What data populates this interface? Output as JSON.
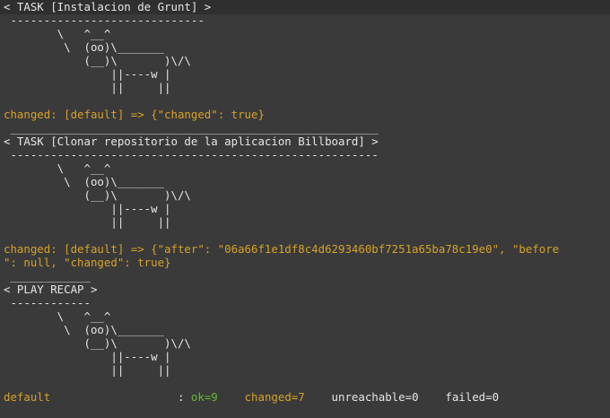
{
  "terminal": {
    "lines": [
      {
        "text": "< TASK [Instalacion de Grunt] >",
        "color": "white"
      },
      {
        "text": " -----------------------------",
        "color": "white"
      },
      {
        "text": "        \\   ^__^",
        "color": "white"
      },
      {
        "text": "         \\  (oo)\\_______",
        "color": "white"
      },
      {
        "text": "            (__)\\       )\\/\\",
        "color": "white"
      },
      {
        "text": "                ||----w |",
        "color": "white"
      },
      {
        "text": "                ||     ||",
        "color": "white"
      },
      {
        "text": "",
        "color": "white"
      },
      {
        "text": "changed: [default] => {\"changed\": true}",
        "color": "changed"
      },
      {
        "text": " _______________________________________________________",
        "color": "white"
      },
      {
        "text": "< TASK [Clonar repositorio de la aplicacion Billboard] >",
        "color": "white"
      },
      {
        "text": " -------------------------------------------------------",
        "color": "white"
      },
      {
        "text": "        \\   ^__^",
        "color": "white"
      },
      {
        "text": "         \\  (oo)\\_______",
        "color": "white"
      },
      {
        "text": "            (__)\\       )\\/\\",
        "color": "white"
      },
      {
        "text": "                ||----w |",
        "color": "white"
      },
      {
        "text": "                ||     ||",
        "color": "white"
      },
      {
        "text": "",
        "color": "white"
      },
      {
        "text": "changed: [default] => {\"after\": \"06a66f1e1df8c4d6293460bf7251a65ba78c19e0\", \"before",
        "color": "changed"
      },
      {
        "text": "\": null, \"changed\": true}",
        "color": "changed"
      },
      {
        "text": " ____________",
        "color": "white"
      },
      {
        "text": "< PLAY RECAP >",
        "color": "white"
      },
      {
        "text": " ------------",
        "color": "white"
      },
      {
        "text": "        \\   ^__^",
        "color": "white"
      },
      {
        "text": "         \\  (oo)\\_______",
        "color": "white"
      },
      {
        "text": "            (__)\\       )\\/\\",
        "color": "white"
      },
      {
        "text": "                ||----w |",
        "color": "white"
      },
      {
        "text": "                ||     ||",
        "color": "white"
      },
      {
        "text": "",
        "color": "white"
      }
    ],
    "recap": {
      "host": "default",
      "sep": "                   : ",
      "ok": "ok=9",
      "gap1": "    ",
      "changed": "changed=7",
      "gap2": "    ",
      "unreachable": "unreachable=0",
      "gap3": "    ",
      "failed": "failed=0"
    }
  },
  "colors": {
    "background": "#3a3a3a",
    "text": "#e6e6e6",
    "changed": "#d6a22a",
    "ok": "#66b832"
  }
}
